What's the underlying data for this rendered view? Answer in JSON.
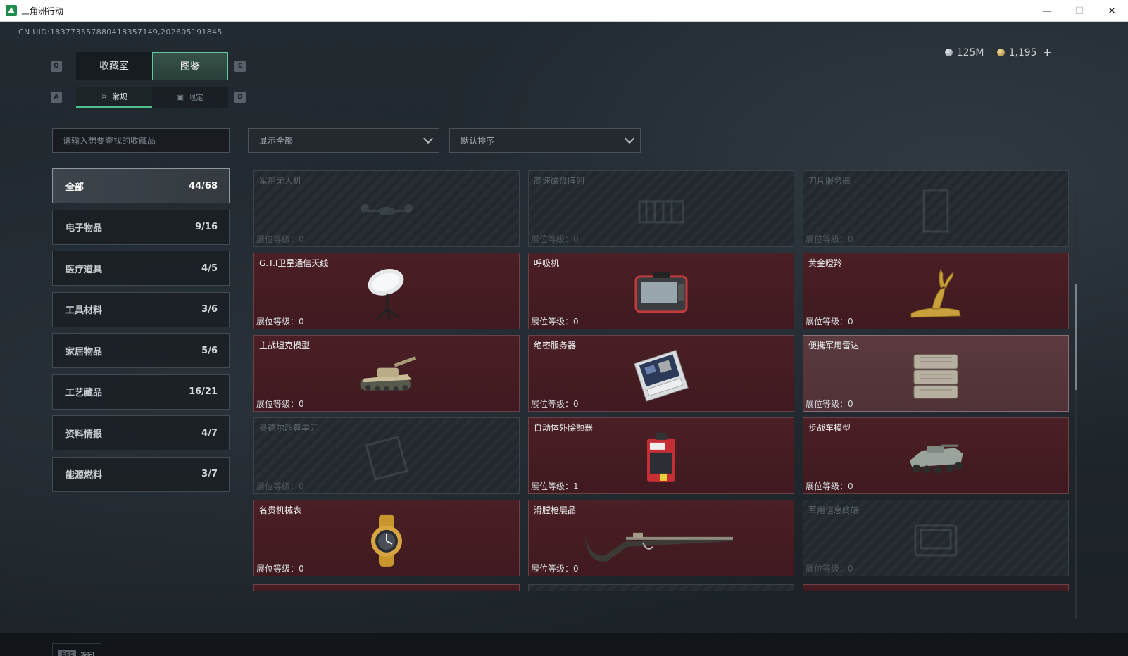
{
  "window": {
    "title": "三角洲行动",
    "minimize": "—",
    "maximize": "☐",
    "close": "✕"
  },
  "header": {
    "uid": "CN UID:183773557880418357149,202605191845",
    "currency": [
      {
        "icon": "silver-coin-icon",
        "value": "125M"
      },
      {
        "icon": "gold-coin-icon",
        "value": "1,195"
      }
    ],
    "add_label": "+"
  },
  "keys": {
    "q": "Q",
    "e": "E",
    "a": "A",
    "d": "D"
  },
  "tabs": [
    {
      "label": "收藏室",
      "active": false
    },
    {
      "label": "图鉴",
      "active": true
    }
  ],
  "subtabs": [
    {
      "label": "常规",
      "icon": "trophy-icon",
      "active": true
    },
    {
      "label": "限定",
      "icon": "image-icon",
      "active": false
    }
  ],
  "search": {
    "placeholder": "请输入想要查找的收藏品"
  },
  "filters": [
    {
      "label": "显示全部"
    },
    {
      "label": "默认排序"
    }
  ],
  "categories": [
    {
      "label": "全部",
      "count": "44/68"
    },
    {
      "label": "电子物品",
      "count": "9/16"
    },
    {
      "label": "医疗道具",
      "count": "4/5"
    },
    {
      "label": "工具材料",
      "count": "3/6"
    },
    {
      "label": "家居物品",
      "count": "5/6"
    },
    {
      "label": "工艺藏品",
      "count": "16/21"
    },
    {
      "label": "资料情报",
      "count": "4/7"
    },
    {
      "label": "能源燃料",
      "count": "3/7"
    }
  ],
  "level_prefix": "展位等级：",
  "items": [
    {
      "name": "军用无人机",
      "level": "展位等级：0",
      "state": "locked",
      "icon": "drone-icon"
    },
    {
      "name": "高速磁盘阵列",
      "level": "展位等级：0",
      "state": "locked",
      "icon": "disk-array-icon"
    },
    {
      "name": "刀片服务器",
      "level": "展位等级：0",
      "state": "locked",
      "icon": "blade-server-icon"
    },
    {
      "name": "G.T.I卫星通信天线",
      "level": "展位等级：0",
      "state": "owned",
      "icon": "satellite-dish-icon"
    },
    {
      "name": "呼吸机",
      "level": "展位等级：0",
      "state": "owned",
      "icon": "ventilator-icon"
    },
    {
      "name": "黄金瞪羚",
      "level": "展位等级：0",
      "state": "owned",
      "icon": "golden-gazelle-icon"
    },
    {
      "name": "主战坦克模型",
      "level": "展位等级：0",
      "state": "owned",
      "icon": "tank-model-icon"
    },
    {
      "name": "绝密服务器",
      "level": "展位等级：0",
      "state": "owned",
      "icon": "server-icon"
    },
    {
      "name": "便携军用雷达",
      "level": "展位等级：0",
      "state": "highlight",
      "icon": "radar-icon"
    },
    {
      "name": "曼德尔超算单元",
      "level": "展位等级：0",
      "state": "locked",
      "icon": "supercomputer-icon"
    },
    {
      "name": "自动体外除颤器",
      "level": "展位等级：1",
      "state": "owned",
      "icon": "defibrillator-icon"
    },
    {
      "name": "步战车模型",
      "level": "展位等级：0",
      "state": "owned",
      "icon": "ifv-model-icon"
    },
    {
      "name": "名贵机械表",
      "level": "展位等级：0",
      "state": "owned",
      "icon": "watch-icon"
    },
    {
      "name": "滑膛枪展品",
      "level": "展位等级：0",
      "state": "owned",
      "icon": "musket-icon"
    },
    {
      "name": "军用信息终端",
      "level": "展位等级：0",
      "state": "locked",
      "icon": "terminal-icon"
    }
  ],
  "footer": {
    "esc_key": "Esc",
    "back_label": "返回"
  },
  "colors": {
    "accent": "#5ec79b",
    "owned_card": "#4a1f25",
    "locked_card": "#22282d"
  }
}
